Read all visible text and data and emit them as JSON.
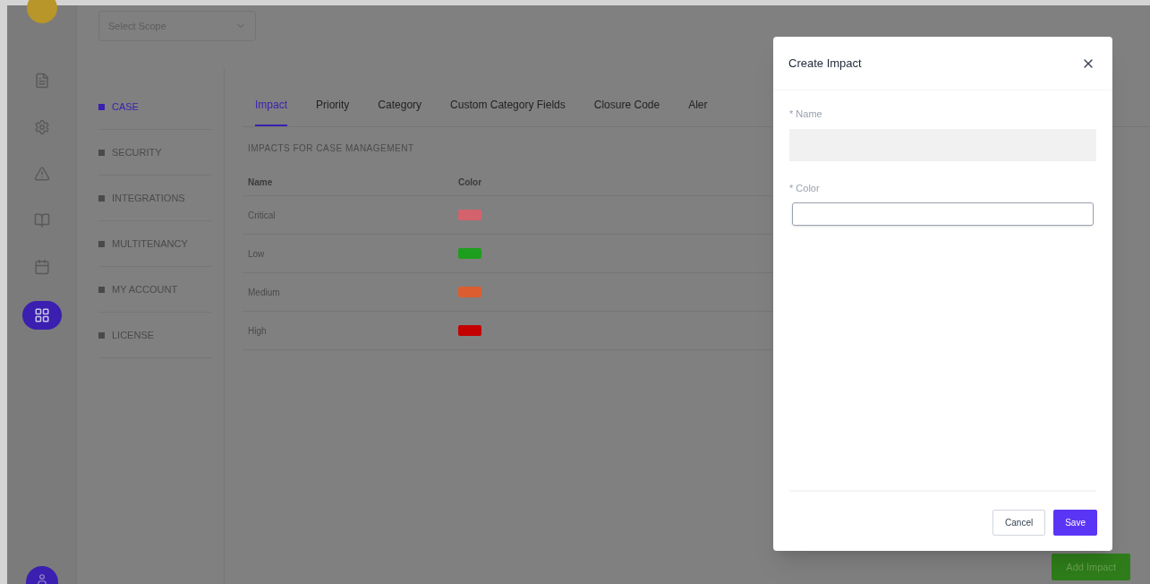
{
  "scope_select": {
    "value": "Select Scope"
  },
  "rail": [
    {
      "kind": "file",
      "selected": false
    },
    {
      "kind": "gear",
      "selected": false
    },
    {
      "kind": "warning",
      "selected": false
    },
    {
      "kind": "book",
      "selected": false
    },
    {
      "kind": "calendar",
      "selected": false
    },
    {
      "kind": "grid",
      "selected": true
    }
  ],
  "settings_menu": [
    {
      "label": "CASE",
      "selected": true
    },
    {
      "label": "SECURITY",
      "selected": false
    },
    {
      "label": "INTEGRATIONS",
      "selected": false
    },
    {
      "label": "MULTITENANCY",
      "selected": false
    },
    {
      "label": "MY ACCOUNT",
      "selected": false
    },
    {
      "label": "LICENSE",
      "selected": false
    }
  ],
  "tabs": [
    {
      "label": "Impact",
      "selected": true
    },
    {
      "label": "Priority",
      "selected": false
    },
    {
      "label": "Category",
      "selected": false
    },
    {
      "label": "Custom Category Fields",
      "selected": false
    },
    {
      "label": "Closure Code",
      "selected": false
    },
    {
      "label": "Aler",
      "selected": false
    }
  ],
  "section_title": "IMPACTS FOR CASE MANAGEMENT",
  "table": {
    "columns": [
      "Name",
      "Color"
    ],
    "rows": [
      {
        "name": "Critical",
        "color": "#d4626c"
      },
      {
        "name": "Low",
        "color": "#1e9e1e"
      },
      {
        "name": "Medium",
        "color": "#dc5e30"
      },
      {
        "name": "High",
        "color": "#c40000"
      }
    ]
  },
  "add_button": "Add Impact",
  "modal": {
    "title": "Create Impact",
    "fields": [
      {
        "label": "* Name",
        "kind": "filled"
      },
      {
        "label": "* Color",
        "kind": "outlined"
      }
    ],
    "buttons": [
      {
        "label": "Cancel",
        "kind": "secondary"
      },
      {
        "label": "Save",
        "kind": "primary"
      }
    ]
  }
}
